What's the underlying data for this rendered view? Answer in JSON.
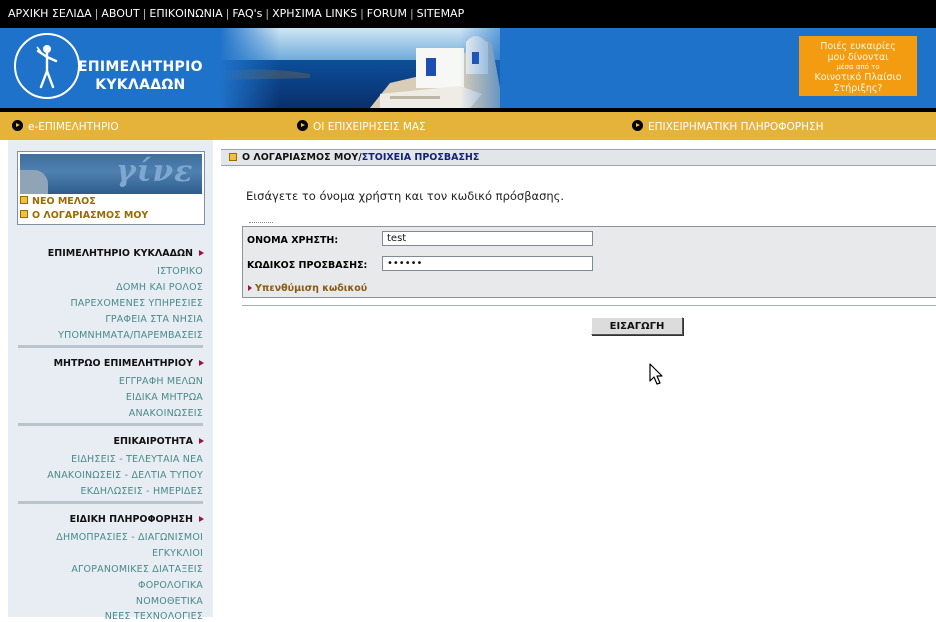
{
  "topnav": {
    "items": [
      "ΑΡΧΙΚΗ ΣΕΛΙΔΑ",
      "ABOUT",
      "ΕΠΙΚΟΙΝΩΝΙΑ",
      "FAQ's",
      "ΧΡΗΣΙΜΑ LINKS",
      "FORUM",
      "SITEMAP"
    ]
  },
  "header": {
    "org_line1": "ΕΠΙΜΕΛΗΤΗΡΙΟ",
    "org_line2": "ΚΥΚΛΑΔΩΝ",
    "promo_line1": "Ποιές ευκαιρίες",
    "promo_line2": "μου δίνονται",
    "promo_line3": "μέσα από το",
    "promo_line4": "Κοινοτικό Πλαίσιο",
    "promo_line5": "Στήριξης?"
  },
  "section_bar": {
    "items": [
      "e-ΕΠΙΜΕΛΗΤΗΡΙΟ",
      "ΟΙ ΕΠΙΧΕΙΡΗΣΕΙΣ ΜΑΣ",
      "ΕΠΙΧΕΙΡΗΜΑΤΙΚΗ ΠΛΗΡΟΦΟΡΗΣΗ"
    ]
  },
  "account_box": {
    "image_word": "γίνε",
    "new_member": "ΝΕΟ ΜΕΛΟΣ",
    "my_account": "Ο ΛΟΓΑΡΙΑΣΜΟΣ ΜΟΥ"
  },
  "sidebar": {
    "sections": [
      {
        "heading": "ΕΠΙΜΕΛΗΤΗΡΙΟ ΚΥΚΛΑΔΩΝ",
        "items": [
          "ΙΣΤΟΡΙΚΟ",
          "ΔΟΜΗ ΚΑΙ ΡΟΛΟΣ",
          "ΠΑΡΕΧΟΜΕΝΕΣ ΥΠΗΡΕΣΙΕΣ",
          "ΓΡΑΦΕΙΑ ΣΤΑ ΝΗΣΙΑ",
          "ΥΠΟΜΝΗΜΑΤΑ/ΠΑΡΕΜΒΑΣΕΙΣ"
        ]
      },
      {
        "heading": "ΜΗΤΡΩΟ ΕΠΙΜΕΛΗΤΗΡΙΟΥ",
        "items": [
          "ΕΓΓΡΑΦΗ ΜΕΛΩΝ",
          "ΕΙΔΙΚΑ ΜΗΤΡΩΑ",
          "ΑΝΑΚΟΙΝΩΣΕΙΣ"
        ]
      },
      {
        "heading": "ΕΠΙΚΑΙΡΟΤΗΤΑ",
        "items": [
          "ΕΙΔΗΣΕΙΣ - ΤΕΛΕΥΤΑΙΑ ΝΕΑ",
          "ΑΝΑΚΟΙΝΩΣΕΙΣ - ΔΕΛΤΙΑ ΤΥΠΟΥ",
          "ΕΚΔΗΛΩΣΕΙΣ - ΗΜΕΡΙΔΕΣ"
        ]
      },
      {
        "heading": "ΕΙΔΙΚΗ ΠΛΗΡΟΦΟΡΗΣΗ",
        "items": [
          "ΔΗΜΟΠΡΑΣΙΕΣ - ΔΙΑΓΩΝΙΣΜΟΙ",
          "ΕΓΚΥΚΛΙΟΙ",
          "ΑΓΟΡΑΝΟΜΙΚΕΣ ΔΙΑΤΑΞΕΙΣ",
          "ΦΟΡΟΛΟΓΙΚΑ",
          "ΝΟΜΟΘΕΤΙΚΑ",
          "ΝΕΕΣ ΤΕΧΝΟΛΟΓΙΕΣ"
        ]
      }
    ]
  },
  "content": {
    "breadcrumb_main": "Ο ΛΟΓΑΡΙΑΣΜΟΣ ΜΟΥ",
    "breadcrumb_sep": "/",
    "breadcrumb_sub": "ΣΤΟΙΧΕΙΑ ΠΡΟΣΒΑΣΗΣ",
    "intro": "Εισάγετε το όνομα χρήστη και τον κωδικό πρόσβασης.",
    "username_label": "ΟΝΟΜΑ ΧΡΗΣΤΗ:",
    "username_value": "test",
    "password_label": "ΚΩΔΙΚΟΣ ΠΡΟΣΒΑΣΗΣ:",
    "password_value": "••••••",
    "reminder": "Υπενθύμιση κωδικού",
    "submit_label": "ΕΙΣΑΓΩΓΗ"
  },
  "colors": {
    "topnav_bg": "#000000",
    "header_bg": "#1f72c9",
    "section_bar_bg": "#e6b33a",
    "sidebar_bg": "#e7edf2",
    "sidebar_link": "#4a8a8a",
    "promo_bg": "#f39c12",
    "accent_arrow": "#a01040"
  }
}
